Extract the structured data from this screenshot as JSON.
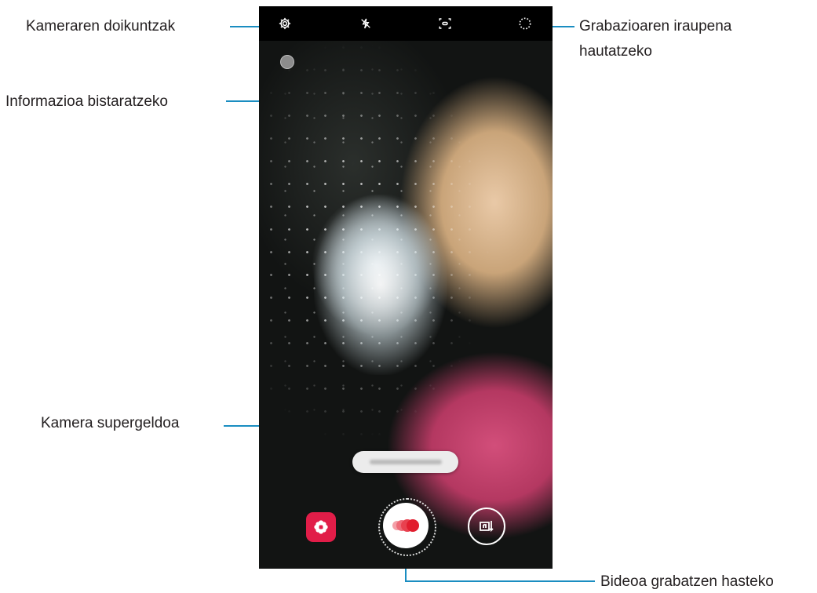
{
  "callouts": {
    "settings": "Kameraren doikuntzak",
    "info": "Informazioa bistaratzeko",
    "duration_line1": "Grabazioaren iraupena",
    "duration_line2": "hautatzeko",
    "super_slow_mo": "Kamera supergeldoa",
    "record": "Bideoa grabatzen hasteko"
  },
  "camera": {
    "top_icons": [
      "gear-icon",
      "flash-off-icon",
      "motion-detect-icon",
      "duration-icon"
    ],
    "mode_label_visible": false,
    "accent": "#1a8dc1",
    "effect_color": "#e11d48",
    "record_color": "#e11d2e"
  }
}
